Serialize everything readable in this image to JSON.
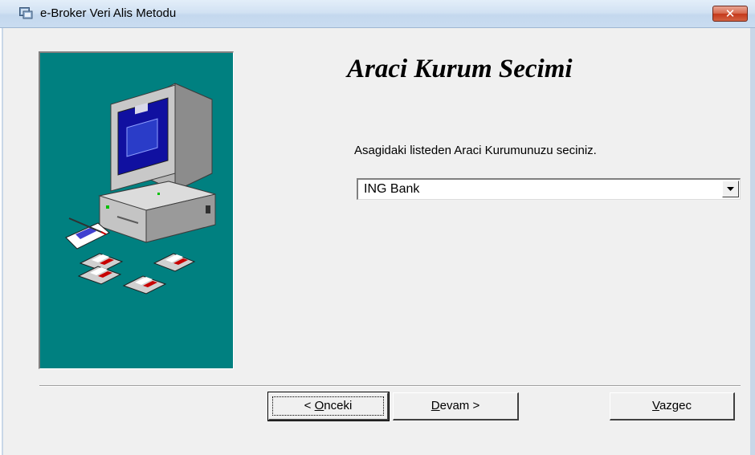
{
  "window": {
    "title": "e-Broker Veri Alis Metodu",
    "close_label": "✕",
    "titlebar_color": "#d2e2f3",
    "close_color": "#c4381a"
  },
  "wizard": {
    "heading": "Araci Kurum Secimi",
    "instruction": "Asagidaki listeden Araci Kurumunuzu seciniz.",
    "broker_select": {
      "selected": "ING Bank"
    },
    "side_panel_color": "#008080"
  },
  "buttons": {
    "back": {
      "mnemonic": "O",
      "rest": "nceki",
      "prefix": "< "
    },
    "next": {
      "mnemonic": "D",
      "rest": "evam >"
    },
    "cancel": {
      "mnemonic": "V",
      "rest": "azgec"
    }
  }
}
